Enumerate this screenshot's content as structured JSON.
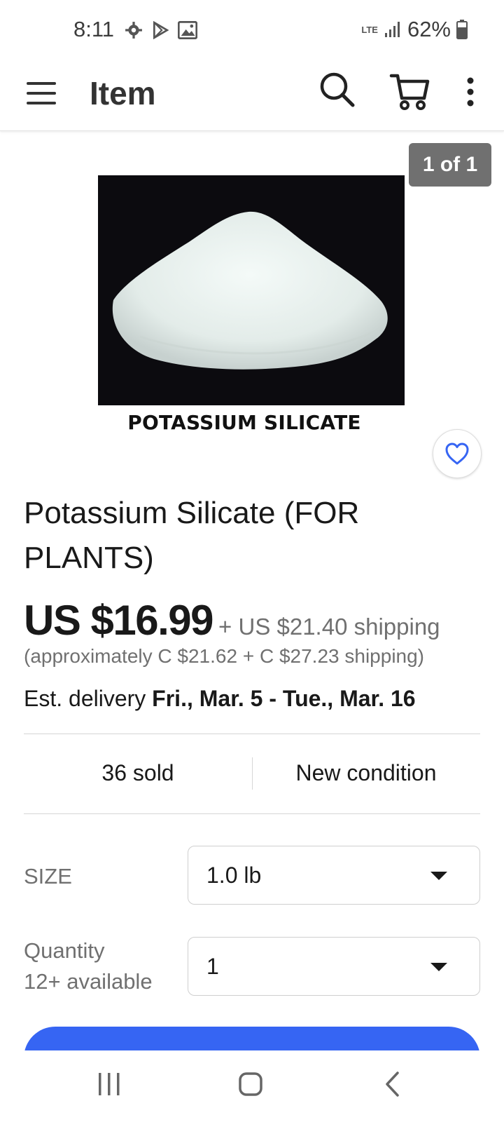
{
  "status_bar": {
    "time": "8:11",
    "network": "LTE",
    "battery": "62%"
  },
  "app_bar": {
    "title": "Item",
    "icons": [
      "menu-icon",
      "search-icon",
      "cart-icon",
      "more-vert-icon"
    ]
  },
  "gallery": {
    "counter": "1 of 1",
    "caption": "POTASSIUM SILICATE"
  },
  "product": {
    "title": "Potassium Silicate (FOR PLANTS)",
    "price": "US $16.99",
    "shipping": "+ US $21.40 shipping",
    "converted": "(approximately C $21.62 + C $27.23 shipping)",
    "delivery_label": "Est. delivery",
    "delivery_dates": "Fri., Mar. 5 - Tue., Mar. 16"
  },
  "stats": {
    "sold": "36 sold",
    "condition": "New condition"
  },
  "options": {
    "size_label": "SIZE",
    "size_value": "1.0 lb",
    "quantity_label": "Quantity",
    "quantity_available": "12+ available",
    "quantity_value": "1"
  },
  "colors": {
    "accent": "#3665f3",
    "watch_heart": "#3665f3",
    "counter_bg": "#707070"
  }
}
